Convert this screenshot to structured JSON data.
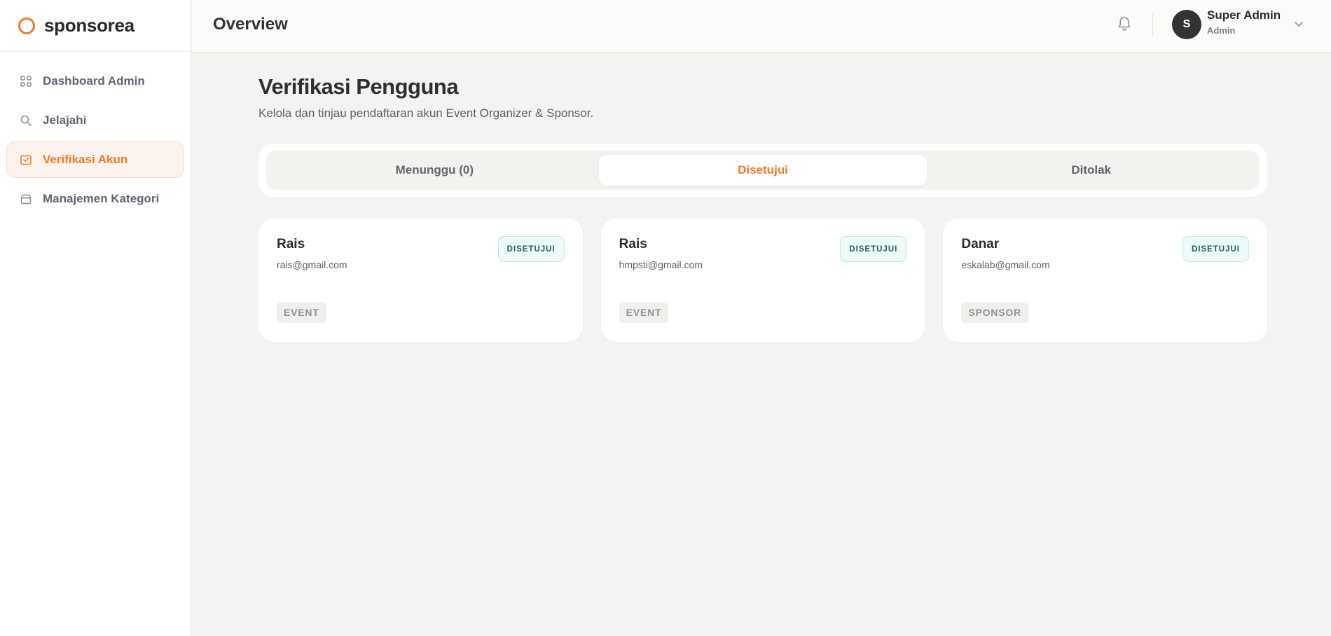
{
  "brand": {
    "name": "sponsorea",
    "accent": "#ef7a2a"
  },
  "sidebar": {
    "items": [
      {
        "label": "Dashboard Admin",
        "icon": "grid-icon"
      },
      {
        "label": "Jelajahi",
        "icon": "search-icon"
      },
      {
        "label": "Verifikasi Akun",
        "icon": "inbox-check-icon",
        "active": true
      },
      {
        "label": "Manajemen Kategori",
        "icon": "archive-icon"
      }
    ]
  },
  "header": {
    "title": "Overview",
    "user": {
      "initial": "S",
      "name": "Super Admin",
      "role": "Admin"
    }
  },
  "main": {
    "title": "Verifikasi Pengguna",
    "subtitle": "Kelola dan tinjau pendaftaran akun Event Organizer & Sponsor.",
    "tabs": [
      {
        "label": "Menunggu (0)"
      },
      {
        "label": "Disetujui",
        "active": true
      },
      {
        "label": "Ditolak"
      }
    ],
    "cards": [
      {
        "name": "Rais",
        "email": "rais@gmail.com",
        "status": "DISETUJUI",
        "type": "EVENT"
      },
      {
        "name": "Rais",
        "email": "hmpsti@gmail.com",
        "status": "DISETUJUI",
        "type": "EVENT"
      },
      {
        "name": "Danar",
        "email": "eskalab@gmail.com",
        "status": "DISETUJUI",
        "type": "SPONSOR"
      }
    ]
  }
}
